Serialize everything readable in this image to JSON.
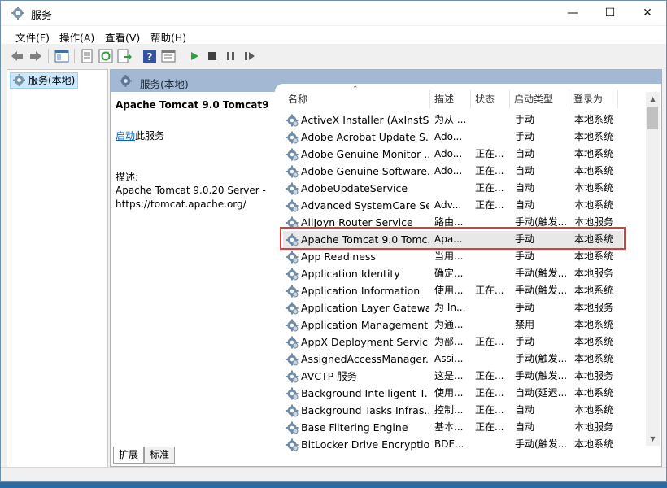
{
  "window": {
    "title": "服务"
  },
  "menu": [
    "文件(F)",
    "操作(A)",
    "查看(V)",
    "帮助(H)"
  ],
  "tree": {
    "root_label": "服务(本地)"
  },
  "pane": {
    "header": "服务(本地)"
  },
  "detail": {
    "service_name": "Apache Tomcat 9.0 Tomcat9",
    "start_link": "启动",
    "start_suffix": "此服务",
    "desc_label": "描述:",
    "desc_text": "Apache Tomcat 9.0.20 Server - https://tomcat.apache.org/"
  },
  "columns": {
    "name": "名称",
    "desc": "描述",
    "state": "状态",
    "startup": "启动类型",
    "logon": "登录为"
  },
  "services": [
    {
      "name": "ActiveX Installer (AxInstSV)",
      "desc": "为从 ...",
      "state": "",
      "startup": "手动",
      "logon": "本地系统"
    },
    {
      "name": "Adobe Acrobat Update S...",
      "desc": "Ado...",
      "state": "",
      "startup": "手动",
      "logon": "本地系统"
    },
    {
      "name": "Adobe Genuine Monitor ...",
      "desc": "Ado...",
      "state": "正在...",
      "startup": "自动",
      "logon": "本地系统"
    },
    {
      "name": "Adobe Genuine Software...",
      "desc": "Ado...",
      "state": "正在...",
      "startup": "自动",
      "logon": "本地系统"
    },
    {
      "name": "AdobeUpdateService",
      "desc": "",
      "state": "正在...",
      "startup": "自动",
      "logon": "本地系统"
    },
    {
      "name": "Advanced SystemCare Se...",
      "desc": "Adv...",
      "state": "正在...",
      "startup": "自动",
      "logon": "本地系统"
    },
    {
      "name": "AllJoyn Router Service",
      "desc": "路由...",
      "state": "",
      "startup": "手动(触发...",
      "logon": "本地服务"
    },
    {
      "name": "Apache Tomcat 9.0 Tomc...",
      "desc": "Apa...",
      "state": "",
      "startup": "手动",
      "logon": "本地系统"
    },
    {
      "name": "App Readiness",
      "desc": "当用...",
      "state": "",
      "startup": "手动",
      "logon": "本地系统"
    },
    {
      "name": "Application Identity",
      "desc": "确定...",
      "state": "",
      "startup": "手动(触发...",
      "logon": "本地服务"
    },
    {
      "name": "Application Information",
      "desc": "使用...",
      "state": "正在...",
      "startup": "手动(触发...",
      "logon": "本地系统"
    },
    {
      "name": "Application Layer Gatewa...",
      "desc": "为 In...",
      "state": "",
      "startup": "手动",
      "logon": "本地服务"
    },
    {
      "name": "Application Management",
      "desc": "为通...",
      "state": "",
      "startup": "禁用",
      "logon": "本地系统"
    },
    {
      "name": "AppX Deployment Servic...",
      "desc": "为部...",
      "state": "正在...",
      "startup": "手动",
      "logon": "本地系统"
    },
    {
      "name": "AssignedAccessManager...",
      "desc": "Assi...",
      "state": "",
      "startup": "手动(触发...",
      "logon": "本地系统"
    },
    {
      "name": "AVCTP 服务",
      "desc": "这是...",
      "state": "正在...",
      "startup": "手动(触发...",
      "logon": "本地服务"
    },
    {
      "name": "Background Intelligent T...",
      "desc": "使用...",
      "state": "正在...",
      "startup": "自动(延迟...",
      "logon": "本地系统"
    },
    {
      "name": "Background Tasks Infras...",
      "desc": "控制...",
      "state": "正在...",
      "startup": "自动",
      "logon": "本地系统"
    },
    {
      "name": "Base Filtering Engine",
      "desc": "基本...",
      "state": "正在...",
      "startup": "自动",
      "logon": "本地服务"
    },
    {
      "name": "BitLocker Drive Encryptio...",
      "desc": "BDE...",
      "state": "",
      "startup": "手动(触发...",
      "logon": "本地系统"
    }
  ],
  "selected_row": 7,
  "tabs": [
    "扩展",
    "标准"
  ],
  "colors": {
    "pane_header": "#a3b9d3",
    "highlight_border": "#e53935",
    "link": "#0066cc"
  },
  "icons": [
    "back-icon",
    "forward-icon",
    "console-tree-icon",
    "properties-icon",
    "refresh-icon",
    "export-icon",
    "help-icon",
    "view-icon",
    "play-icon",
    "stop-icon",
    "pause-icon",
    "restart-icon",
    "gear-icon"
  ]
}
